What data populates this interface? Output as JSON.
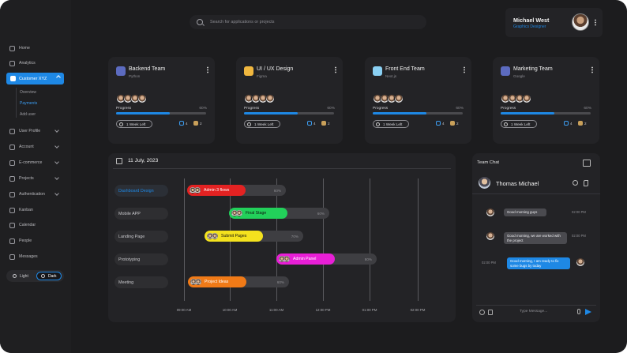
{
  "sidebar": {
    "items": [
      {
        "label": "Home"
      },
      {
        "label": "Analytics"
      },
      {
        "label": "Customer XYZ"
      },
      {
        "label": "User Profile"
      },
      {
        "label": "Account"
      },
      {
        "label": "E-commerce"
      },
      {
        "label": "Projects"
      },
      {
        "label": "Authentication"
      },
      {
        "label": "Kanban"
      },
      {
        "label": "Calendar"
      },
      {
        "label": "People"
      },
      {
        "label": "Messages"
      }
    ],
    "subitems": [
      {
        "label": "Overview"
      },
      {
        "label": "Payments"
      },
      {
        "label": "Add user"
      }
    ],
    "theme": {
      "light": "Light",
      "dark": "Dark"
    }
  },
  "search": {
    "placeholder": "Search for applications or projects"
  },
  "profile": {
    "name": "Michael West",
    "role": "Graphics Designer"
  },
  "teams": [
    {
      "title": "Backend Team",
      "sub": "Python",
      "progress_label": "Progress",
      "progress_text": "60%",
      "progress": 0.6,
      "time": "1 Week Left",
      "messages": "4",
      "files": "2",
      "logo_color": "#5c6bc0"
    },
    {
      "title": "UI / UX Design",
      "sub": "Figma",
      "progress_label": "Progress",
      "progress_text": "60%",
      "progress": 0.6,
      "time": "1 Week Left",
      "messages": "4",
      "files": "2",
      "logo_color": "#f0b73f"
    },
    {
      "title": "Front End Team",
      "sub": "Next.js",
      "progress_label": "Progress",
      "progress_text": "60%",
      "progress": 0.6,
      "time": "1 Week Left",
      "messages": "4",
      "files": "2",
      "logo_color": "#8ad0f3"
    },
    {
      "title": "Marketing Team",
      "sub": "Google",
      "progress_label": "Progress",
      "progress_text": "60%",
      "progress": 0.6,
      "time": "1 Week Left",
      "messages": "4",
      "files": "2",
      "logo_color": "#5c6bc0"
    }
  ],
  "timeline": {
    "date": "11 July, 2023",
    "rows": [
      {
        "label": "Dashboard Design",
        "task": "Admin 3 flows",
        "color": "#e32222",
        "text_color": "#ffffff",
        "ghost": "60%"
      },
      {
        "label": "Mobile APP",
        "task": "Final Stage",
        "color": "#22d05a",
        "text_color": "#101010",
        "ghost": "60%"
      },
      {
        "label": "Landing Page",
        "task": "Submit Pages",
        "color": "#f4e21e",
        "text_color": "#101010",
        "ghost": "70%"
      },
      {
        "label": "Prototyping",
        "task": "Admin Panel",
        "color": "#e81fd6",
        "text_color": "#ffffff",
        "ghost": "80%"
      },
      {
        "label": "Meeting",
        "task": "Project Ideas",
        "color": "#f07a17",
        "text_color": "#ffffff",
        "ghost": "60%"
      }
    ],
    "ticks": [
      "09:00 AM",
      "10:00 AM",
      "11:00 AM",
      "12:00 PM",
      "01:00 PM",
      "02:00 PM"
    ]
  },
  "chat": {
    "title": "Team Chat",
    "contact": "Thomas Michael",
    "messages": [
      {
        "text": "Good morning guys",
        "time": "02:00 PM",
        "from": "in"
      },
      {
        "text": "Good morning, we are worked with the project",
        "time": "02:00 PM",
        "from": "in"
      },
      {
        "text": "Good morning, I am ready to fix some bugs by today",
        "time": "02:00 PM",
        "from": "out"
      }
    ],
    "placeholder": "Type Message..."
  },
  "colors": {
    "accent": "#1e88e5",
    "background": "#1c1c1e",
    "panel": "#232326"
  }
}
